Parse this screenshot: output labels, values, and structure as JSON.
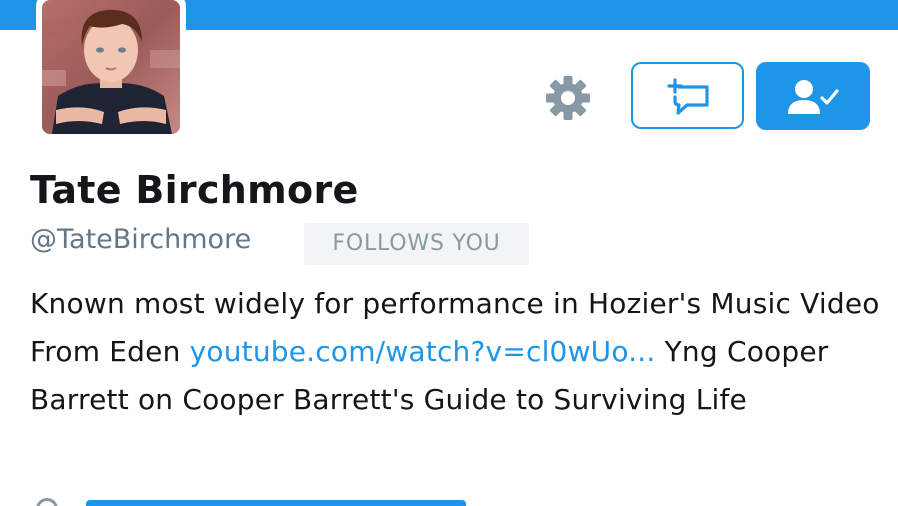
{
  "colors": {
    "accent": "#1f95e8",
    "text": "#14171a",
    "muted": "#657786",
    "badge_bg": "#f2f4f6",
    "badge_text": "#8899a6"
  },
  "header": {
    "banner_color": "#1f95e8"
  },
  "profile": {
    "avatar_icon": "profile-photo",
    "name": "Tate Birchmore",
    "handle": "@TateBirchmore",
    "follows_badge": "FOLLOWS YOU",
    "bio": {
      "text_1": "Known most widely for performance in Hozier's Music Video From Eden ",
      "link": "youtube.com/watch?v=cl0wUo...",
      "text_2": " Yng Cooper Barrett on Cooper Barrett's Guide to Surviving Life"
    }
  },
  "actions": {
    "settings_icon": "gear-icon",
    "direct_message_icon": "message-plus-icon",
    "following_icon": "person-check-icon"
  }
}
